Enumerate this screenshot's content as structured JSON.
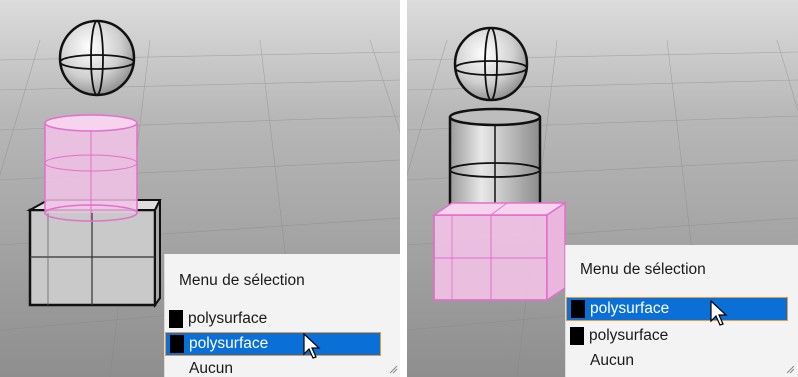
{
  "panels": [
    {
      "menu": {
        "title": "Menu de sélection",
        "items": [
          {
            "label": "polysurface",
            "selected": false
          },
          {
            "label": "polysurface",
            "selected": true
          },
          {
            "label": "Aucun",
            "selected": false
          }
        ]
      }
    },
    {
      "menu": {
        "title": "Menu de sélection",
        "items": [
          {
            "label": "polysurface",
            "selected": true
          },
          {
            "label": "polysurface",
            "selected": false
          },
          {
            "label": "Aucun",
            "selected": false
          }
        ]
      }
    }
  ],
  "colors": {
    "selection_highlight": "#0a6fd6",
    "selection_border": "#ee9a3c",
    "preselection_pink": "#f2c2e6",
    "viewport_background": "#9c9c9c",
    "object_gray": "#c8c8c8"
  },
  "icons": [
    "arrow-cursor-icon",
    "resize-grip-icon",
    "object-color-swatch-icon"
  ]
}
